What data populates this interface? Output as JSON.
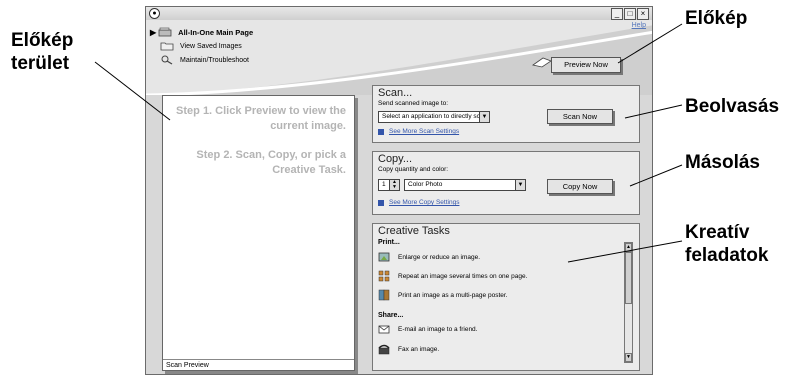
{
  "callouts": {
    "preview_area": [
      "Előkép",
      "terület"
    ],
    "preview": "Előkép",
    "scan": "Beolvasás",
    "copy": "Másolás",
    "creative": [
      "Kreatív",
      "feladatok"
    ]
  },
  "window": {
    "title_controls": [
      "_",
      "□",
      "×"
    ],
    "help": "Help"
  },
  "nav": {
    "items": [
      "All-In-One Main Page",
      "View Saved Images",
      "Maintain/Troubleshoot"
    ]
  },
  "preview_button": "Preview Now",
  "preview_panel": {
    "step1": "Step 1.  Click Preview to view the current image.",
    "step2": "Step 2.  Scan, Copy, or pick a Creative Task.",
    "footer": "Scan Preview"
  },
  "scan": {
    "title": "Scan...",
    "subtitle": "Send scanned image to:",
    "select_value": "Select an application to directly scan to...",
    "button": "Scan Now",
    "more_link": "See More Scan Settings"
  },
  "copy": {
    "title": "Copy...",
    "subtitle": "Copy quantity and color:",
    "quantity": "1",
    "color_value": "Color Photo",
    "button": "Copy Now",
    "more_link": "See More Copy Settings"
  },
  "creative": {
    "title": "Creative Tasks",
    "print_heading": "Print...",
    "print_items": [
      "Enlarge or reduce an image.",
      "Repeat an image several times on one page.",
      "Print an image as a multi-page poster."
    ],
    "share_heading": "Share...",
    "share_items": [
      "E-mail an image to a friend.",
      "Fax an image."
    ]
  },
  "colors": {
    "link": "#3355aa",
    "step_text": "#b4b4b4",
    "window_bg": "#d8d8d8"
  }
}
